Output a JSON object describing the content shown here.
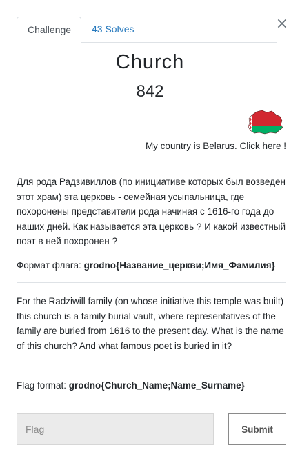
{
  "modal": {
    "close_glyph": "×",
    "tabs": [
      {
        "label": "Challenge"
      },
      {
        "label": "43 Solves"
      }
    ],
    "title": "Church",
    "points": "842",
    "country_link": "My country is Belarus. Click here !",
    "description_ru_text": "Для рода Радзивиллов (по инициативе которых был возведен этот храм) эта церковь - семейная усыпальница, где похоронены представители рода начиная с 1616-го года до наших дней. Как называется эта церковь ? И какой известный поэт в ней похоронен ?",
    "flag_format_ru_label": "Формат флага:",
    "flag_format_ru_value": "grodno{Название_церкви;Имя_Фамилия}",
    "description_en_text": "For the Radziwill family (on whose initiative this temple was built) this church is a family burial vault, where representatives of the family are buried from 1616 to the present day. What is the name of this church? And what famous poet is buried in it?",
    "flag_format_en_label": "Flag format:",
    "flag_format_en_value": "grodno{Church_Name;Name_Surname}",
    "flag_input": {
      "placeholder": "Flag",
      "value": ""
    },
    "submit_label": "Submit"
  },
  "colors": {
    "link_blue": "#2779bd",
    "belarus_red": "#d22730",
    "belarus_green": "#00af66",
    "input_bg": "#ebebeb"
  },
  "icons": {
    "close": "close-icon",
    "flag": "belarus-map-flag-icon"
  }
}
